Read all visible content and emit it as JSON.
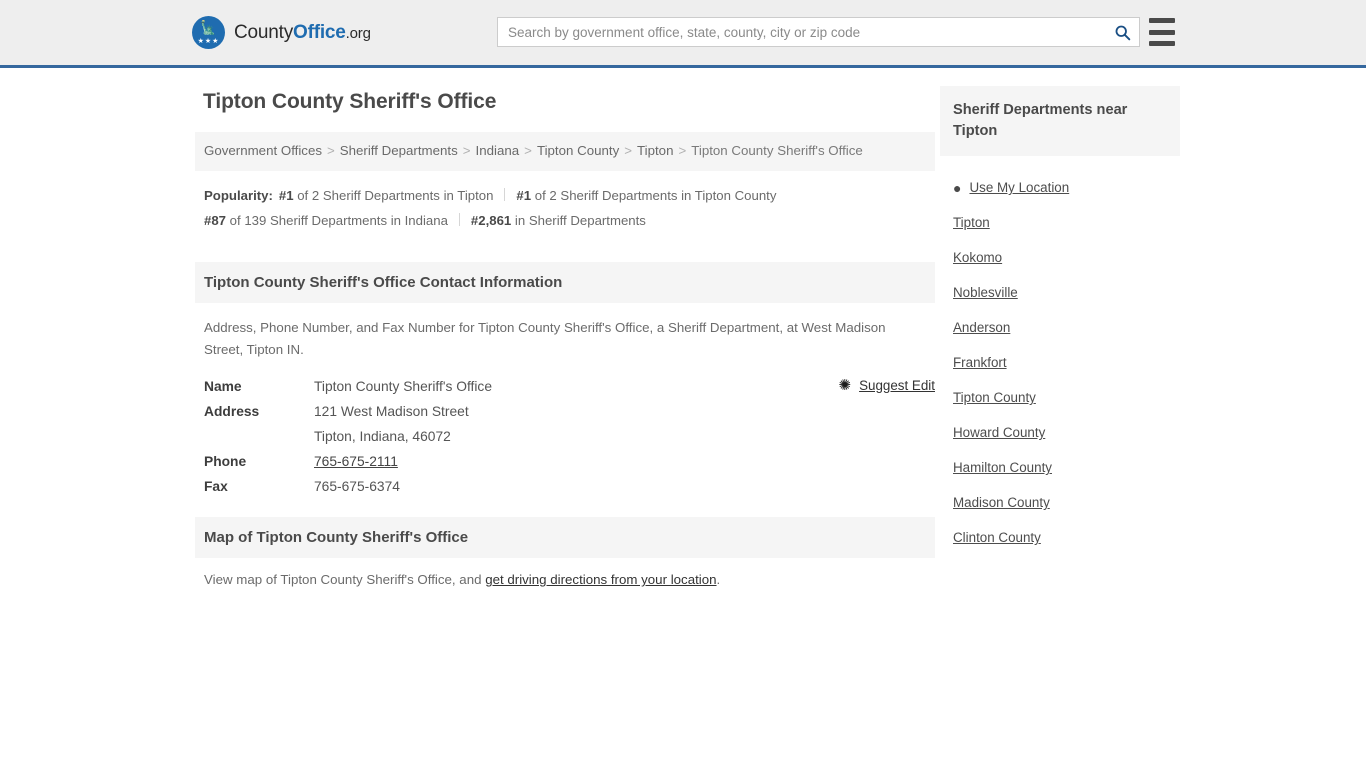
{
  "header": {
    "logo": {
      "part1": "County",
      "part2": "Office",
      "part3": ".org",
      "eagle_icon": "eagle-icon",
      "stars": "★★★"
    },
    "search": {
      "placeholder": "Search by government office, state, county, city or zip code",
      "value": "",
      "search_icon": "search-icon"
    },
    "menu_icon": "hamburger-menu-icon",
    "accent_color": "#35689e",
    "background_color": "#eeeeee"
  },
  "main": {
    "page_title": "Tipton County Sheriff's Office",
    "breadcrumb": {
      "separator": ">",
      "items": [
        {
          "label": "Government Offices",
          "link": true
        },
        {
          "label": "Sheriff Departments",
          "link": true
        },
        {
          "label": "Indiana",
          "link": true
        },
        {
          "label": "Tipton County",
          "link": true
        },
        {
          "label": "Tipton",
          "link": true
        },
        {
          "label": "Tipton County Sheriff's Office",
          "link": false
        }
      ]
    },
    "popularity": {
      "label": "Popularity:",
      "items": [
        {
          "rank": "#1",
          "rest": " of 2 Sheriff Departments in Tipton"
        },
        {
          "rank": "#1",
          "rest": " of 2 Sheriff Departments in Tipton County"
        },
        {
          "rank": "#87",
          "rest": " of 139 Sheriff Departments in Indiana"
        },
        {
          "rank": "#2,861",
          "rest": " in Sheriff Departments"
        }
      ]
    },
    "contact_section": {
      "heading": "Tipton County Sheriff's Office Contact Information",
      "description": "Address, Phone Number, and Fax Number for Tipton County Sheriff's Office, a Sheriff Department, at West Madison Street, Tipton IN.",
      "suggest_edit": {
        "label": "Suggest Edit",
        "icon": "edit-pencil-icon"
      },
      "rows": [
        {
          "key": "Name",
          "value": "Tipton County Sheriff's Office",
          "link": false
        },
        {
          "key": "Address",
          "value": "121 West Madison Street",
          "link": false
        },
        {
          "key": "",
          "value": "Tipton, Indiana, 46072",
          "link": false
        },
        {
          "key": "Phone",
          "value": "765-675-2111",
          "link": true
        },
        {
          "key": "Fax",
          "value": "765-675-6374",
          "link": false
        }
      ]
    },
    "map_section": {
      "heading": "Map of Tipton County Sheriff's Office",
      "text_before": "View map of Tipton County Sheriff's Office, and ",
      "link_text": "get driving directions from your location",
      "text_after": "."
    }
  },
  "sidebar": {
    "heading": "Sheriff Departments near Tipton",
    "use_my_location": {
      "label": "Use My Location",
      "icon": "map-pin-icon"
    },
    "items": [
      {
        "label": "Tipton"
      },
      {
        "label": "Kokomo"
      },
      {
        "label": "Noblesville"
      },
      {
        "label": "Anderson"
      },
      {
        "label": "Frankfort"
      },
      {
        "label": "Tipton County"
      },
      {
        "label": "Howard County"
      },
      {
        "label": "Hamilton County"
      },
      {
        "label": "Madison County"
      },
      {
        "label": "Clinton County"
      }
    ]
  }
}
